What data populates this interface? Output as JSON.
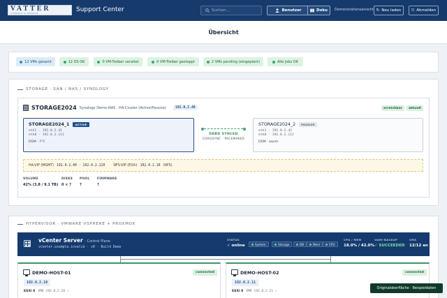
{
  "header": {
    "logo_text": "VATTER",
    "logo_sub": "CONNECT & MANAGE",
    "app_title": "Support Center",
    "search_placeholder": "Suchen…",
    "btn_user": "Benutzer",
    "btn_docs": "Doku",
    "demo_label": "Demonstrationsansicht",
    "btn_reload": "Neu laden",
    "btn_logout": "Abmelden"
  },
  "page": {
    "title": "Übersicht"
  },
  "summary_pills": [
    {
      "label": "12 VMs gesamt",
      "variant": "info"
    },
    {
      "label": "12 OS OK",
      "variant": "ok"
    },
    {
      "label": "0 VM-Treiber veraltet",
      "variant": "ok"
    },
    {
      "label": "0 VM-Treiber gestoppt",
      "variant": "ok"
    },
    {
      "label": "2 VMs pending (eingeplant)",
      "variant": "ok"
    },
    {
      "label": "Alle Jobs OK",
      "variant": "ok"
    }
  ],
  "storage": {
    "section_title": "STORAGE · SAN / NAS / SYNOLOGY",
    "name": "STORAGE2024",
    "description": "Synology Demo-NAS · HA-Cluster (Active/Passive)",
    "ip": "192.0.2.40",
    "chip_reachable": "erreichbar",
    "chip_current": "aktuell",
    "node1": {
      "name": "STORAGE2024_1",
      "tag": "ACTIVE",
      "eth1": "eth1 · 192.0.2.41",
      "eth0": "eth0 · 192.0.2.111",
      "dsm": "DSM · 7°C"
    },
    "node2": {
      "name": "STORAGE2024_2",
      "tag": "PASSIVE",
      "eth1": "eth1 · 192.0.2.42",
      "eth0": "eth0 · 192.0.2.112",
      "dsm": "DSM · warm"
    },
    "sync_label": "DRBD SYNCED",
    "sync_sub": "COROSYNC · PACEMAKER",
    "vip": {
      "ha_label": "HA-VIP (MGMT)",
      "ha_value": "192.0.2.40 · 192.0.2.110",
      "nfs_label": "NFS-VIP (ESXi)",
      "nfs_value": "192.0.2.10",
      "nfs_note": "(NFS)"
    },
    "stats": [
      {
        "label": "VOLUME",
        "value": "42% (3.8 / 9.1 TB)"
      },
      {
        "label": "DISKS",
        "value": "0 × ?"
      },
      {
        "label": "POOL",
        "value": "?"
      },
      {
        "label": "FIRMWARE",
        "value": "?"
      }
    ]
  },
  "hypervisor": {
    "section_title": "HYPERVISOR · VMWARE VSPHERE + PROXMOX",
    "vcenter": {
      "title": "vCenter Server",
      "title_sub": "· Control Plane",
      "subtitle": "vcenter.example.invalid · v8 · Build Demo",
      "status_label": "STATUS",
      "status_value": "✓ online",
      "chips": [
        "System",
        "Storage",
        "DB",
        "Mem",
        "CPU"
      ],
      "cpu_label": "CPU / MEM",
      "cpu_value": "18.0% / 42.0%",
      "backup_label": "VAMI-BACKUP",
      "backup_value": "✓ SUCCEEDED",
      "vms_label": "VMS",
      "vms_value": "12/12 an"
    },
    "hosts": [
      {
        "name": "DEMO-HOST-01",
        "status": "connected",
        "ip": "192.0.2.10",
        "esxi_label": "ESXi 8",
        "vmk": "VMK 192.0.2.20 ✓"
      },
      {
        "name": "DEMO-HOST-02",
        "status": "connected",
        "ip": "192.0.2.11",
        "esxi_label": "ESXi 8",
        "vmk": "VMK 192.0.2.21 ✓"
      }
    ]
  },
  "toast": {
    "text": "Originaloberfläche · Beispieldaten"
  },
  "colors": {
    "header": "#163a6b",
    "ok": "#dcf3e4",
    "info": "#dbecf7",
    "vcenter": "#143a6e",
    "toast": "#0f3a2b"
  }
}
